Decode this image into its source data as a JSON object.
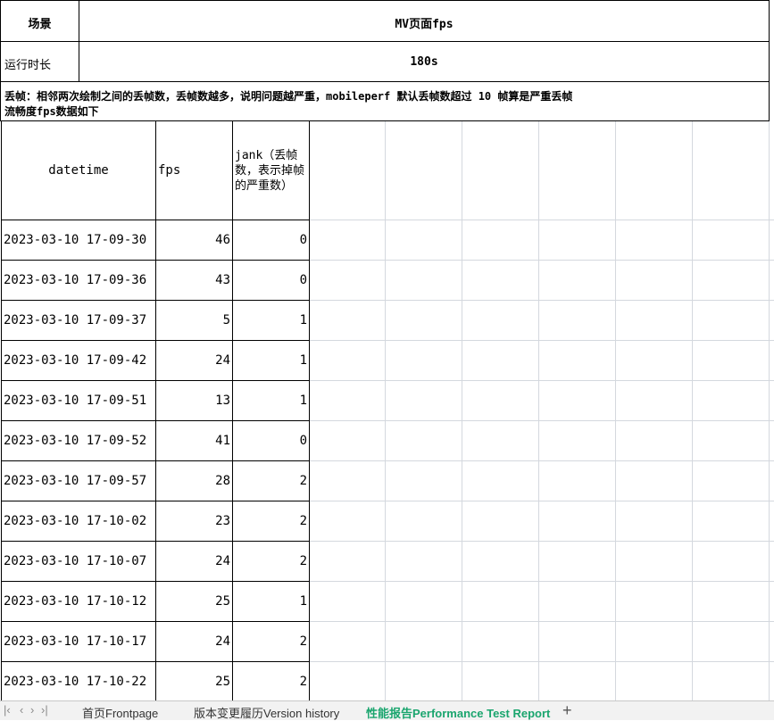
{
  "header": {
    "scene_label": "场景",
    "scene_value": "MV页面fps",
    "duration_label": "运行时长",
    "duration_value": "180s",
    "note_line1": "丢帧：相邻两次绘制之间的丢帧数，丢帧数越多，说明问题越严重，mobileperf 默认丢帧数超过 10 帧算是严重丢帧",
    "note_line2": "流畅度fps数据如下"
  },
  "table": {
    "columns": [
      "datetime",
      "fps",
      "jank（丢帧数，表示掉帧的严重数）"
    ],
    "rows": [
      {
        "datetime": "2023-03-10 17-09-30",
        "fps": "46",
        "jank": "0"
      },
      {
        "datetime": "2023-03-10 17-09-36",
        "fps": "43",
        "jank": "0"
      },
      {
        "datetime": "2023-03-10 17-09-37",
        "fps": "5",
        "jank": "1"
      },
      {
        "datetime": "2023-03-10 17-09-42",
        "fps": "24",
        "jank": "1"
      },
      {
        "datetime": "2023-03-10 17-09-51",
        "fps": "13",
        "jank": "1"
      },
      {
        "datetime": "2023-03-10 17-09-52",
        "fps": "41",
        "jank": "0"
      },
      {
        "datetime": "2023-03-10 17-09-57",
        "fps": "28",
        "jank": "2"
      },
      {
        "datetime": "2023-03-10 17-10-02",
        "fps": "23",
        "jank": "2"
      },
      {
        "datetime": "2023-03-10 17-10-07",
        "fps": "24",
        "jank": "2"
      },
      {
        "datetime": "2023-03-10 17-10-12",
        "fps": "25",
        "jank": "1"
      },
      {
        "datetime": "2023-03-10 17-10-17",
        "fps": "24",
        "jank": "2"
      },
      {
        "datetime": "2023-03-10 17-10-22",
        "fps": "25",
        "jank": "2"
      }
    ]
  },
  "tabs": [
    {
      "label": "首页Frontpage",
      "active": false
    },
    {
      "label": "版本变更履历Version history",
      "active": false
    },
    {
      "label": "性能报告Performance Test Report",
      "active": true
    }
  ],
  "colors": {
    "active_tab": "#1aa56e",
    "grid": "#d4d8de"
  }
}
